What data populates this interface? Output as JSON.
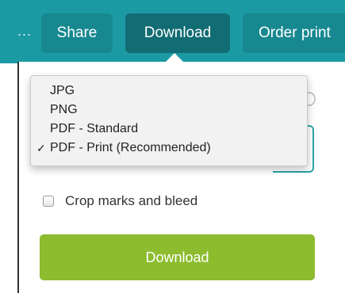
{
  "header": {
    "overflow": "...",
    "tabs": [
      {
        "label": "Share"
      },
      {
        "label": "Download"
      },
      {
        "label": "Order print"
      }
    ]
  },
  "format_dropdown": {
    "options": [
      {
        "label": "JPG",
        "selected": false
      },
      {
        "label": "PNG",
        "selected": false
      },
      {
        "label": "PDF - Standard",
        "selected": false
      },
      {
        "label": "PDF - Print (Recommended)",
        "selected": true
      }
    ],
    "check_mark": "✓"
  },
  "options": {
    "crop_marks_label": "Crop marks and bleed",
    "crop_marks_checked": false
  },
  "download_button": {
    "label": "Download"
  },
  "colors": {
    "header_bg": "#1c9aa3",
    "active_tab": "#116c73",
    "button_green": "#8dbc2f"
  }
}
